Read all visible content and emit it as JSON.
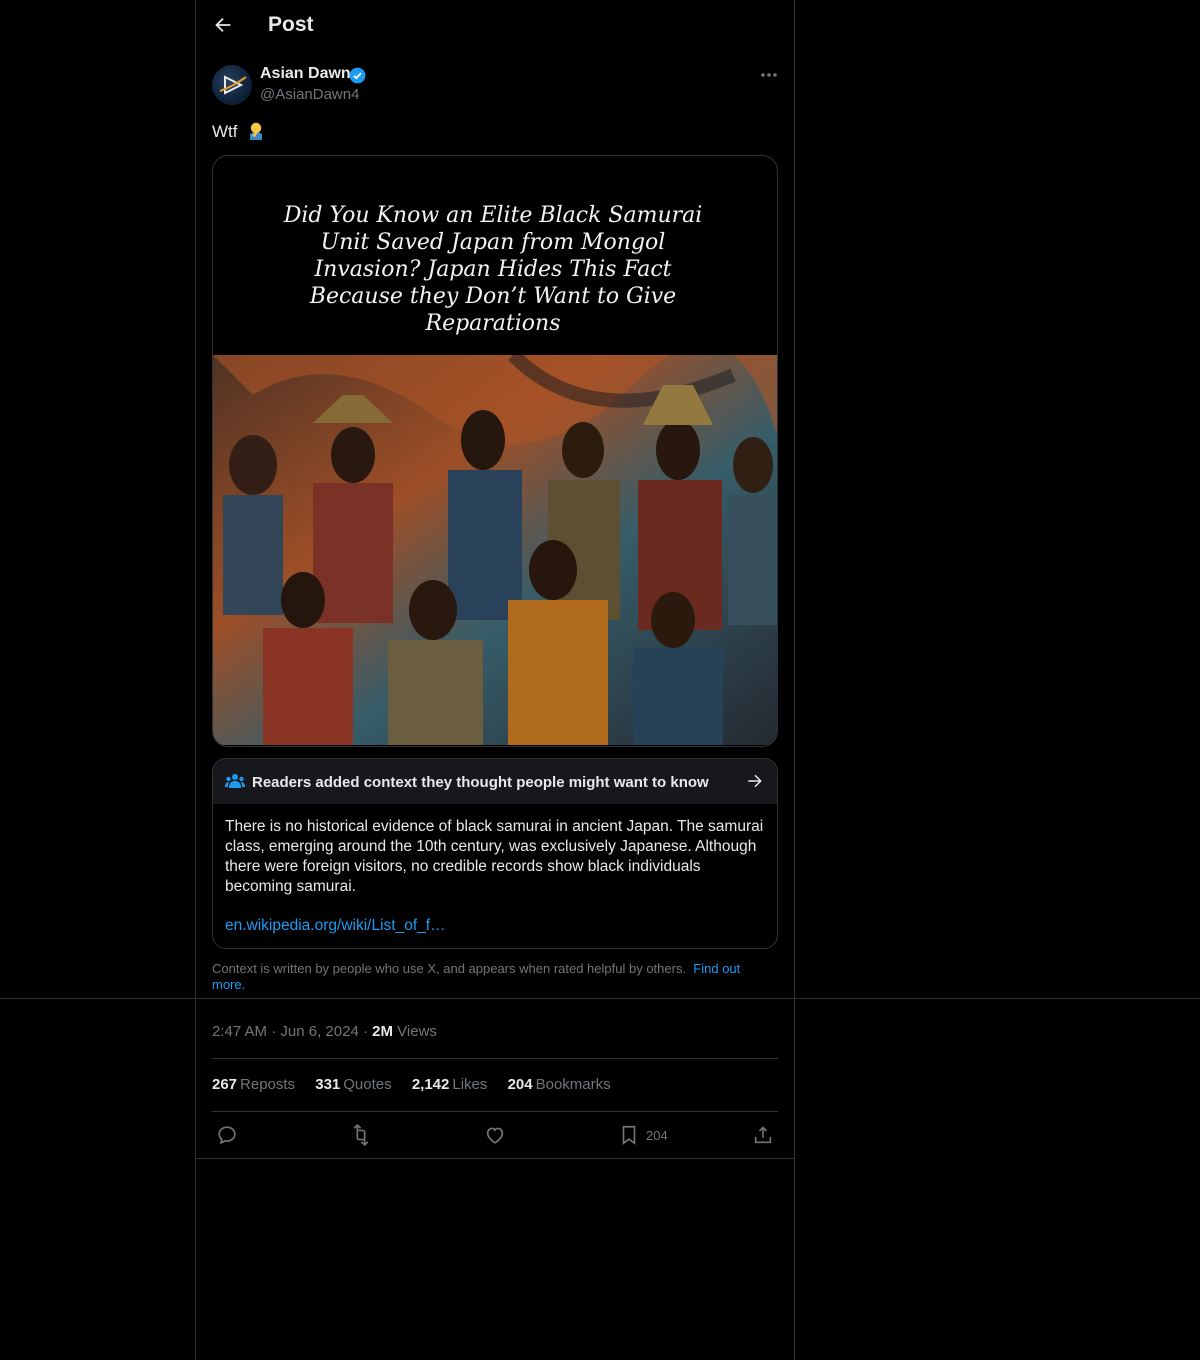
{
  "header": {
    "title": "Post"
  },
  "author": {
    "name": "Asian Dawn",
    "handle": "@AsianDawn4"
  },
  "post": {
    "text": "Wtf",
    "image_caption": "Did You Know an Elite Black Samurai\nUnit Saved Japan from Mongol\nInvasion? Japan Hides This Fact\nBecause they Don’t Want to Give\nReparations"
  },
  "community_note": {
    "title": "Readers added context they thought people might want to know",
    "body": "There is no historical evidence of black samurai in ancient Japan. The samurai class, emerging around the 10th century, was exclusively Japanese. Although there were foreign visitors, no credible records show black individuals becoming samurai.",
    "link": "en.wikipedia.org/wiki/List_of_f…"
  },
  "disclaimer": {
    "text": "Context is written by people who use X, and appears when rated helpful by others.",
    "link": "Find out more."
  },
  "meta": {
    "time": "2:47 AM",
    "sep": "·",
    "date": "Jun 6, 2024",
    "views_count": "2M",
    "views_label": "Views"
  },
  "stats": {
    "reposts_count": "267",
    "reposts_label": "Reposts",
    "quotes_count": "331",
    "quotes_label": "Quotes",
    "likes_count": "2,142",
    "likes_label": "Likes",
    "bookmarks_count": "204",
    "bookmarks_label": "Bookmarks"
  },
  "actions": {
    "bookmark_count": "204"
  },
  "icons": [
    "back-arrow-icon",
    "verified-badge-icon",
    "more-icon",
    "man-facepalming-emoji-icon",
    "people-icon",
    "arrow-right-icon",
    "reply-icon",
    "repost-icon",
    "like-icon",
    "bookmark-icon",
    "share-icon"
  ],
  "colors": {
    "background": "#000000",
    "accent": "#1d9bf0",
    "border": "#2f3336",
    "secondary_text": "#71767b"
  }
}
